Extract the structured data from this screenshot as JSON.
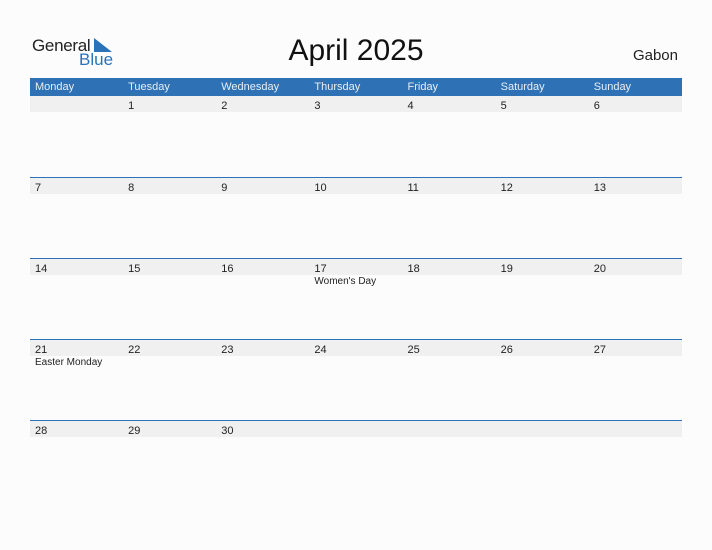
{
  "logo": {
    "general": "General",
    "blue": "Blue"
  },
  "title": "April 2025",
  "country": "Gabon",
  "weekdays": [
    "Monday",
    "Tuesday",
    "Wednesday",
    "Thursday",
    "Friday",
    "Saturday",
    "Sunday"
  ],
  "weeks": [
    {
      "days": [
        "",
        "1",
        "2",
        "3",
        "4",
        "5",
        "6"
      ],
      "events": [
        "",
        "",
        "",
        "",
        "",
        "",
        ""
      ]
    },
    {
      "days": [
        "7",
        "8",
        "9",
        "10",
        "11",
        "12",
        "13"
      ],
      "events": [
        "",
        "",
        "",
        "",
        "",
        "",
        ""
      ]
    },
    {
      "days": [
        "14",
        "15",
        "16",
        "17",
        "18",
        "19",
        "20"
      ],
      "events": [
        "",
        "",
        "",
        "Women's Day",
        "",
        "",
        ""
      ]
    },
    {
      "days": [
        "21",
        "22",
        "23",
        "24",
        "25",
        "26",
        "27"
      ],
      "events": [
        "Easter Monday",
        "",
        "",
        "",
        "",
        "",
        ""
      ]
    },
    {
      "days": [
        "28",
        "29",
        "30",
        "",
        "",
        "",
        ""
      ],
      "events": [
        "",
        "",
        "",
        "",
        "",
        "",
        ""
      ]
    }
  ],
  "colors": {
    "accent": "#2e72b5",
    "band": "#f0f0f0"
  }
}
